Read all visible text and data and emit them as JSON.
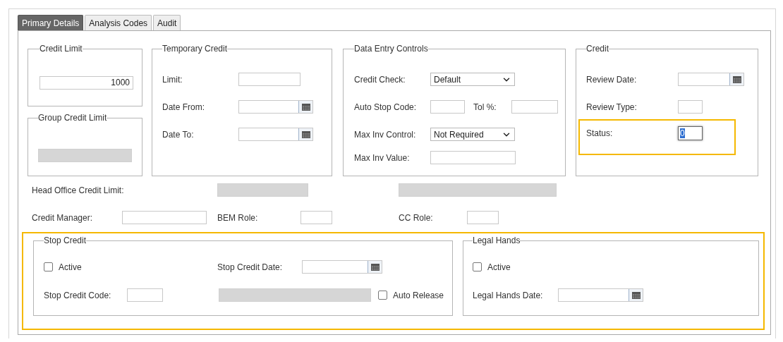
{
  "tabs": [
    {
      "label": "Primary Details",
      "selected": true
    },
    {
      "label": "Analysis Codes",
      "selected": false
    },
    {
      "label": "Audit",
      "selected": false
    }
  ],
  "credit_limit": {
    "legend": "Credit Limit",
    "value": "1000"
  },
  "group_credit_limit": {
    "legend": "Group Credit Limit"
  },
  "temporary_credit": {
    "legend": "Temporary Credit",
    "fields": [
      {
        "label": "Limit:",
        "kind": "text"
      },
      {
        "label": "Date From:",
        "kind": "date"
      },
      {
        "label": "Date To:",
        "kind": "date"
      }
    ]
  },
  "data_entry_controls": {
    "legend": "Data Entry Controls",
    "credit_check": {
      "label": "Credit Check:",
      "value": "Default"
    },
    "auto_stop_code": {
      "label": "Auto Stop Code:"
    },
    "tol": {
      "label": "Tol %:"
    },
    "max_inv_control": {
      "label": "Max Inv Control:",
      "value": "Not Required"
    },
    "max_inv_value": {
      "label": "Max Inv Value:"
    }
  },
  "credit": {
    "legend": "Credit",
    "review_date": {
      "label": "Review Date:"
    },
    "review_type": {
      "label": "Review Type:"
    },
    "status": {
      "label": "Status:",
      "value": "0",
      "text_selected": true,
      "callout": true
    }
  },
  "head_office_credit_limit": {
    "label": "Head Office Credit Limit:"
  },
  "credit_manager": {
    "label": "Credit Manager:"
  },
  "bem_role": {
    "label": "BEM Role:"
  },
  "cc_role": {
    "label": "CC Role:"
  },
  "credit_stops": {
    "callout": true,
    "stop_credit": {
      "legend": "Stop Credit",
      "active": {
        "label": "Active",
        "checked": false
      },
      "stop_credit_date": {
        "label": "Stop Credit Date:"
      },
      "stop_credit_code": {
        "label": "Stop Credit Code:"
      },
      "auto_release": {
        "label": "Auto Release",
        "checked": false
      }
    },
    "legal_hands": {
      "legend": "Legal Hands",
      "active": {
        "label": "Active",
        "checked": false
      },
      "legal_hands_date": {
        "label": "Legal Hands Date:"
      }
    }
  }
}
